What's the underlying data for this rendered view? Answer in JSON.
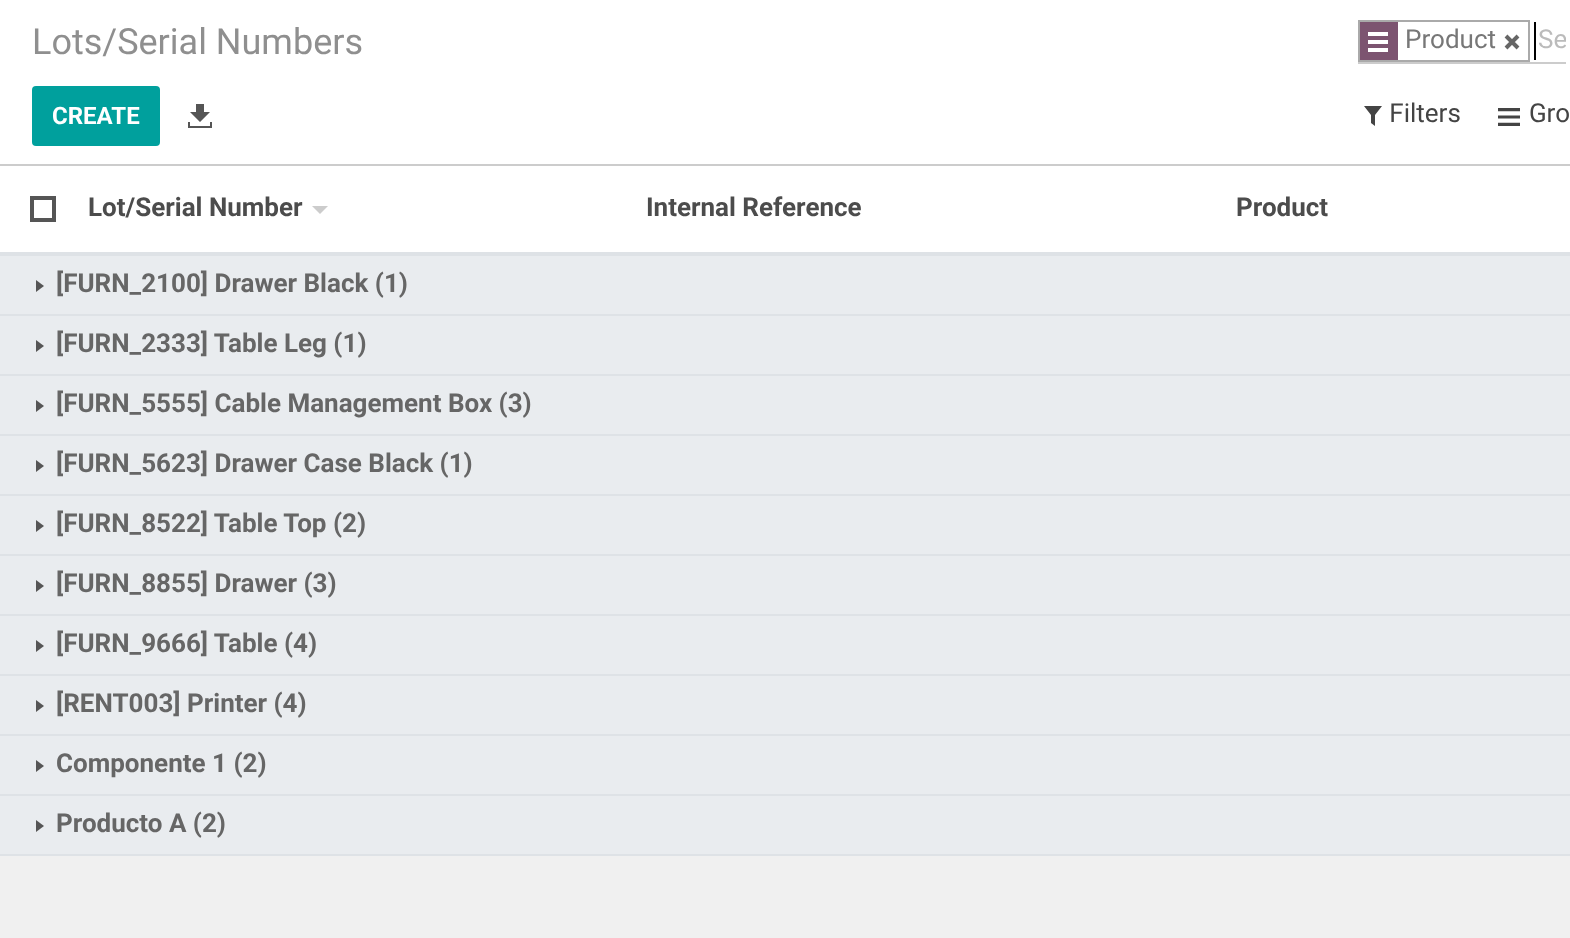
{
  "title": "Lots/Serial Numbers",
  "actions": {
    "create": "CREATE"
  },
  "search": {
    "facets": [
      {
        "label": "Product"
      }
    ],
    "placeholder": "Se"
  },
  "filters": {
    "filters": "Filters",
    "group_by": "Gro"
  },
  "table": {
    "select_all": {
      "checked": false
    },
    "columns": [
      {
        "label": "Lot/Serial Number",
        "sorted": true
      },
      {
        "label": "Internal Reference",
        "sorted": false
      },
      {
        "label": "Product",
        "sorted": false
      }
    ],
    "groups": [
      {
        "label": "[FURN_2100] Drawer Black (1)",
        "expanded": false
      },
      {
        "label": "[FURN_2333] Table Leg (1)",
        "expanded": false
      },
      {
        "label": "[FURN_5555] Cable Management Box (3)",
        "expanded": false
      },
      {
        "label": "[FURN_5623] Drawer Case Black (1)",
        "expanded": false
      },
      {
        "label": "[FURN_8522] Table Top (2)",
        "expanded": false
      },
      {
        "label": "[FURN_8855] Drawer (3)",
        "expanded": false
      },
      {
        "label": "[FURN_9666] Table (4)",
        "expanded": false
      },
      {
        "label": "[RENT003] Printer (4)",
        "expanded": false
      },
      {
        "label": "Componente 1 (2)",
        "expanded": false
      },
      {
        "label": "Producto A (2)",
        "expanded": false
      }
    ]
  }
}
